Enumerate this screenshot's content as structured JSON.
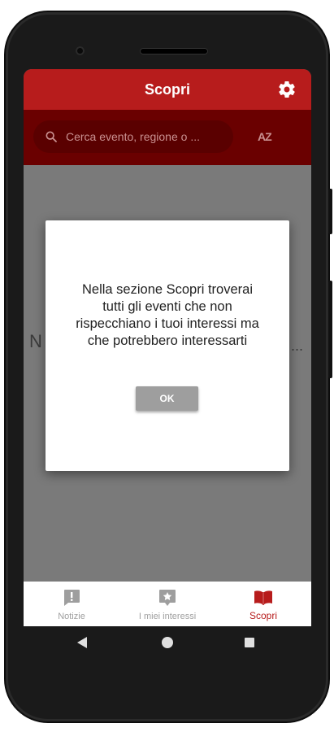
{
  "app": {
    "title": "Scopri"
  },
  "search": {
    "placeholder": "Cerca evento, regione o ...",
    "sort_label": "AZ"
  },
  "background": {
    "left_fragment": "N",
    "right_fragment": "..."
  },
  "dialog": {
    "message": "Nella sezione Scopri troverai tutti gli eventi che non rispecchiano i tuoi interessi ma che potrebbero interessarti",
    "ok_label": "OK"
  },
  "bottom_nav": {
    "items": [
      {
        "label": "Notizie",
        "icon": "exclamation-icon",
        "active": false
      },
      {
        "label": "I miei interessi",
        "icon": "star-badge-icon",
        "active": false
      },
      {
        "label": "Scopri",
        "icon": "book-icon",
        "active": true
      }
    ]
  },
  "colors": {
    "primary": "#b71c1c",
    "search_bar": "#6a0000",
    "inactive": "#9e9e9e"
  }
}
